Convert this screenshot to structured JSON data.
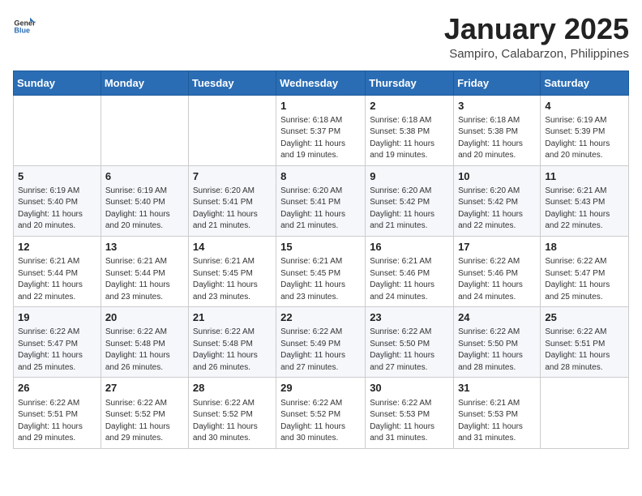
{
  "header": {
    "logo_general": "General",
    "logo_blue": "Blue",
    "month": "January 2025",
    "location": "Sampiro, Calabarzon, Philippines"
  },
  "weekdays": [
    "Sunday",
    "Monday",
    "Tuesday",
    "Wednesday",
    "Thursday",
    "Friday",
    "Saturday"
  ],
  "weeks": [
    [
      {
        "day": "",
        "info": ""
      },
      {
        "day": "",
        "info": ""
      },
      {
        "day": "",
        "info": ""
      },
      {
        "day": "1",
        "info": "Sunrise: 6:18 AM\nSunset: 5:37 PM\nDaylight: 11 hours and 19 minutes."
      },
      {
        "day": "2",
        "info": "Sunrise: 6:18 AM\nSunset: 5:38 PM\nDaylight: 11 hours and 19 minutes."
      },
      {
        "day": "3",
        "info": "Sunrise: 6:18 AM\nSunset: 5:38 PM\nDaylight: 11 hours and 20 minutes."
      },
      {
        "day": "4",
        "info": "Sunrise: 6:19 AM\nSunset: 5:39 PM\nDaylight: 11 hours and 20 minutes."
      }
    ],
    [
      {
        "day": "5",
        "info": "Sunrise: 6:19 AM\nSunset: 5:40 PM\nDaylight: 11 hours and 20 minutes."
      },
      {
        "day": "6",
        "info": "Sunrise: 6:19 AM\nSunset: 5:40 PM\nDaylight: 11 hours and 20 minutes."
      },
      {
        "day": "7",
        "info": "Sunrise: 6:20 AM\nSunset: 5:41 PM\nDaylight: 11 hours and 21 minutes."
      },
      {
        "day": "8",
        "info": "Sunrise: 6:20 AM\nSunset: 5:41 PM\nDaylight: 11 hours and 21 minutes."
      },
      {
        "day": "9",
        "info": "Sunrise: 6:20 AM\nSunset: 5:42 PM\nDaylight: 11 hours and 21 minutes."
      },
      {
        "day": "10",
        "info": "Sunrise: 6:20 AM\nSunset: 5:42 PM\nDaylight: 11 hours and 22 minutes."
      },
      {
        "day": "11",
        "info": "Sunrise: 6:21 AM\nSunset: 5:43 PM\nDaylight: 11 hours and 22 minutes."
      }
    ],
    [
      {
        "day": "12",
        "info": "Sunrise: 6:21 AM\nSunset: 5:44 PM\nDaylight: 11 hours and 22 minutes."
      },
      {
        "day": "13",
        "info": "Sunrise: 6:21 AM\nSunset: 5:44 PM\nDaylight: 11 hours and 23 minutes."
      },
      {
        "day": "14",
        "info": "Sunrise: 6:21 AM\nSunset: 5:45 PM\nDaylight: 11 hours and 23 minutes."
      },
      {
        "day": "15",
        "info": "Sunrise: 6:21 AM\nSunset: 5:45 PM\nDaylight: 11 hours and 23 minutes."
      },
      {
        "day": "16",
        "info": "Sunrise: 6:21 AM\nSunset: 5:46 PM\nDaylight: 11 hours and 24 minutes."
      },
      {
        "day": "17",
        "info": "Sunrise: 6:22 AM\nSunset: 5:46 PM\nDaylight: 11 hours and 24 minutes."
      },
      {
        "day": "18",
        "info": "Sunrise: 6:22 AM\nSunset: 5:47 PM\nDaylight: 11 hours and 25 minutes."
      }
    ],
    [
      {
        "day": "19",
        "info": "Sunrise: 6:22 AM\nSunset: 5:47 PM\nDaylight: 11 hours and 25 minutes."
      },
      {
        "day": "20",
        "info": "Sunrise: 6:22 AM\nSunset: 5:48 PM\nDaylight: 11 hours and 26 minutes."
      },
      {
        "day": "21",
        "info": "Sunrise: 6:22 AM\nSunset: 5:48 PM\nDaylight: 11 hours and 26 minutes."
      },
      {
        "day": "22",
        "info": "Sunrise: 6:22 AM\nSunset: 5:49 PM\nDaylight: 11 hours and 27 minutes."
      },
      {
        "day": "23",
        "info": "Sunrise: 6:22 AM\nSunset: 5:50 PM\nDaylight: 11 hours and 27 minutes."
      },
      {
        "day": "24",
        "info": "Sunrise: 6:22 AM\nSunset: 5:50 PM\nDaylight: 11 hours and 28 minutes."
      },
      {
        "day": "25",
        "info": "Sunrise: 6:22 AM\nSunset: 5:51 PM\nDaylight: 11 hours and 28 minutes."
      }
    ],
    [
      {
        "day": "26",
        "info": "Sunrise: 6:22 AM\nSunset: 5:51 PM\nDaylight: 11 hours and 29 minutes."
      },
      {
        "day": "27",
        "info": "Sunrise: 6:22 AM\nSunset: 5:52 PM\nDaylight: 11 hours and 29 minutes."
      },
      {
        "day": "28",
        "info": "Sunrise: 6:22 AM\nSunset: 5:52 PM\nDaylight: 11 hours and 30 minutes."
      },
      {
        "day": "29",
        "info": "Sunrise: 6:22 AM\nSunset: 5:52 PM\nDaylight: 11 hours and 30 minutes."
      },
      {
        "day": "30",
        "info": "Sunrise: 6:22 AM\nSunset: 5:53 PM\nDaylight: 11 hours and 31 minutes."
      },
      {
        "day": "31",
        "info": "Sunrise: 6:21 AM\nSunset: 5:53 PM\nDaylight: 11 hours and 31 minutes."
      },
      {
        "day": "",
        "info": ""
      }
    ]
  ]
}
